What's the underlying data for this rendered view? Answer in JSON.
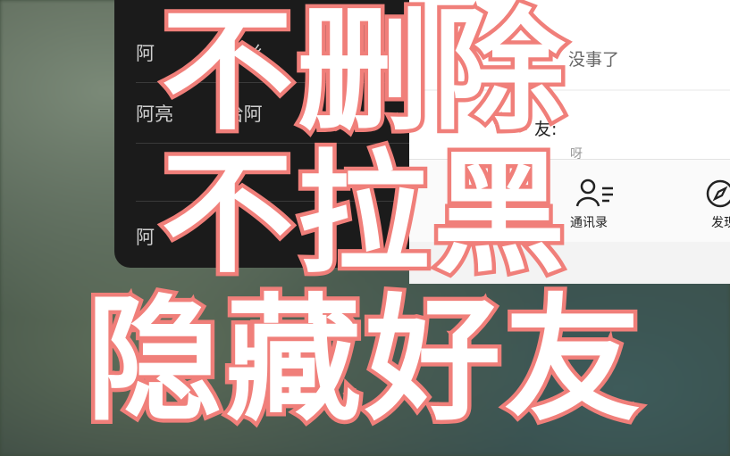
{
  "background": {
    "color": "#3b4a3a"
  },
  "dark_panel": {
    "rows": [
      {
        "name": "阿",
        "note": "（加纟"
      },
      {
        "name": "阿亮",
        "note": "（哈阿"
      },
      {
        "name": "",
        "note": ""
      },
      {
        "name": "阿",
        "note": ""
      }
    ]
  },
  "chat_panel": {
    "message_text": "没事了",
    "contact_snippet": "友:",
    "sub_snippet": "呀"
  },
  "tabbar": {
    "tabs": [
      {
        "label": "通讯录",
        "icon": "contacts-icon"
      },
      {
        "label": "发现",
        "icon": "discover-icon"
      }
    ]
  },
  "overlay": {
    "line1": "不删除",
    "line2": "不拉黑",
    "line3": "隐藏好友",
    "stroke_color": "#f07f7a",
    "fill_color": "#ffffff"
  }
}
